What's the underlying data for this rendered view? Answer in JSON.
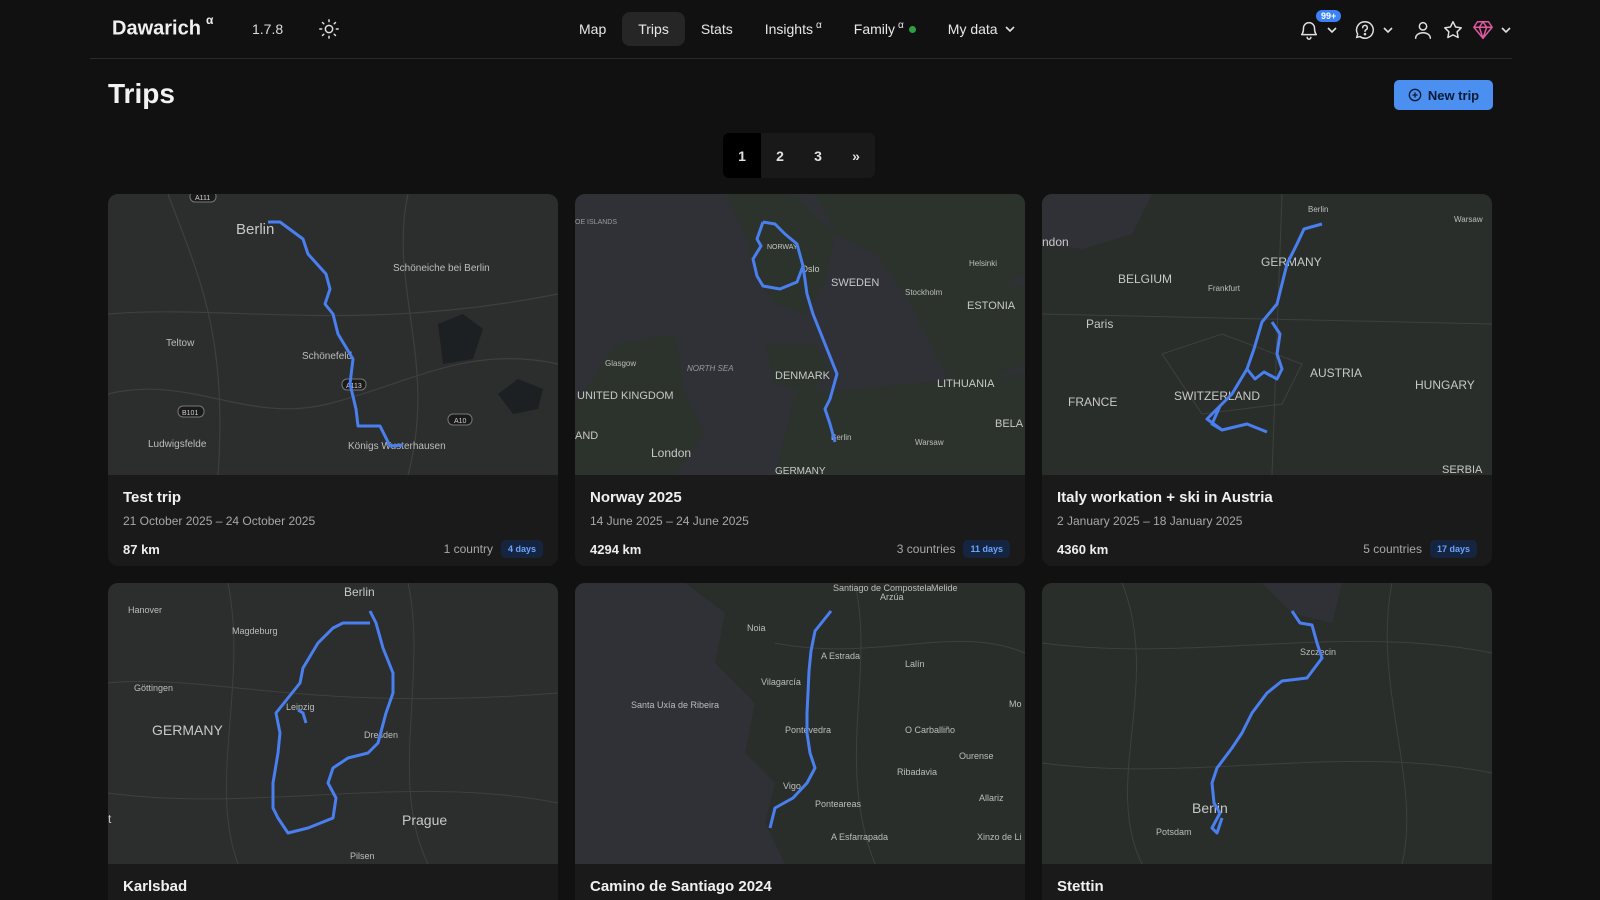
{
  "header": {
    "brand": "Dawarich",
    "brand_sup": "α",
    "version": "1.7.8",
    "nav": [
      {
        "label": "Map",
        "sup": ""
      },
      {
        "label": "Trips",
        "sup": ""
      },
      {
        "label": "Stats",
        "sup": ""
      },
      {
        "label": "Insights",
        "sup": "α"
      },
      {
        "label": "Family",
        "sup": "α"
      },
      {
        "label": "My data",
        "sup": ""
      }
    ],
    "active_nav": "Trips",
    "notifications_badge": "99+",
    "accent_color": "#3b82f6",
    "icons": [
      "sun-icon",
      "bell-icon",
      "help-circle-icon",
      "user-icon",
      "star-icon",
      "gem-icon",
      "chevron-down-icon"
    ]
  },
  "page": {
    "title": "Trips",
    "new_trip_label": "New trip"
  },
  "pagination": {
    "pages": [
      "1",
      "2",
      "3",
      "»"
    ],
    "current": "1"
  },
  "trips": [
    {
      "name": "Test trip",
      "dates": "21 October 2025 – 24 October 2025",
      "distance": "87 km",
      "countries": "1 country",
      "days": "4 days",
      "map_labels": [
        "Berlin",
        "Schöneiche bei Berlin",
        "Teltow",
        "Schönefeld",
        "Ludwigsfelde",
        "Königs Wusterhausen",
        "A111",
        "A113",
        "B101",
        "A10"
      ]
    },
    {
      "name": "Norway 2025",
      "dates": "14 June 2025 – 24 June 2025",
      "distance": "4294 km",
      "countries": "3 countries",
      "days": "11 days",
      "map_labels": [
        "OE ISLANDS",
        "NORWAY",
        "Oslo",
        "SWEDEN",
        "Helsinki",
        "Stockholm",
        "ESTONIA",
        "NORTH SEA",
        "Glasgow",
        "DENMARK",
        "UNITED KINGDOM",
        "LITHUANIA",
        "AND",
        "London",
        "Berlin",
        "Warsaw",
        "BELA",
        "GERMANY"
      ]
    },
    {
      "name": "Italy workation + ski in Austria",
      "dates": "2 January 2025 – 18 January 2025",
      "distance": "4360 km",
      "countries": "5 countries",
      "days": "17 days",
      "map_labels": [
        "Berlin",
        "Warsaw",
        "ndon",
        "GERMANY",
        "BELGIUM",
        "Frankfurt",
        "Paris",
        "AUSTRIA",
        "HUNGARY",
        "FRANCE",
        "SWITZERLAND",
        "SERBIA"
      ]
    },
    {
      "name": "Karlsbad",
      "map_labels": [
        "Berlin",
        "Hanover",
        "Magdeburg",
        "Göttingen",
        "GERMANY",
        "Leipzig",
        "Dresden",
        "Prague",
        "Pilsen",
        "t"
      ]
    },
    {
      "name": "Camino de Santiago 2024",
      "map_labels": [
        "Santiago de Compostela",
        "Arzúa",
        "Melide",
        "Noia",
        "A Estrada",
        "Lalín",
        "Vilagarcía",
        "Santa Uxía de Ribeira",
        "Pontevedra",
        "O Carballiño",
        "Mo",
        "Ourense",
        "Ribadavia",
        "Vigo",
        "Allariz",
        "Ponteareas",
        "A Esfarrapada",
        "Xinzo de Li"
      ]
    },
    {
      "name": "Stettin",
      "map_labels": [
        "Szczecin",
        "Berlin",
        "Potsdam"
      ]
    }
  ]
}
